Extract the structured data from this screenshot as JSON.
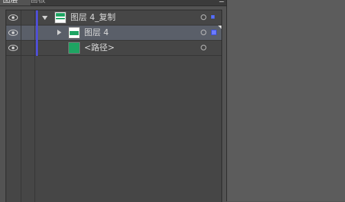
{
  "tabs": [
    {
      "label": "图层"
    },
    {
      "label": "画板"
    }
  ],
  "panel_menu_icon": "panel-menu-icon",
  "colors": {
    "layer_color": "#4f4fd9",
    "thumb_green": "#1ea462",
    "selected_row": "#5a5f69"
  },
  "layers": [
    {
      "name": "图层 4_复制",
      "expanded": true,
      "visible": true
    },
    {
      "name": "图层 4",
      "expanded": false,
      "visible": true,
      "selected": true
    },
    {
      "name": "<路径>",
      "visible": true
    }
  ]
}
